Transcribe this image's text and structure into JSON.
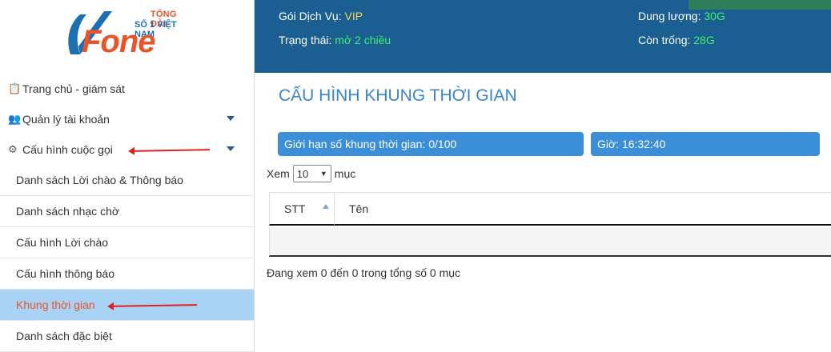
{
  "logo": {
    "tagline1": "TỔNG ĐÀI",
    "tagline2": "SỐ 1 VIỆT NAM",
    "brand": "Fone"
  },
  "sidebar": {
    "items": [
      {
        "label": "Trang chủ - giám sát",
        "icon": "clipboard-icon"
      },
      {
        "label": "Quản lý tài khoản",
        "icon": "users-icon",
        "caret": true
      },
      {
        "label": "Cấu hình cuộc gọi",
        "icon": "gears-icon",
        "caret": true
      }
    ],
    "subitems": [
      {
        "label": "Danh sách Lời chào & Thông báo"
      },
      {
        "label": "Danh sách nhạc chờ"
      },
      {
        "label": "Cấu hình Lời chào"
      },
      {
        "label": "Cấu hình thông báo"
      },
      {
        "label": "Khung thời gian",
        "active": true
      },
      {
        "label": "Danh sách đặc biệt"
      }
    ]
  },
  "topbar": {
    "package_label": "Gói Dịch Vụ: ",
    "package_value": "VIP",
    "status_label": "Trạng thái: ",
    "status_value": "mở 2 chiều",
    "capacity_label": "Dung lượng: ",
    "capacity_value": "30G",
    "free_label": "Còn trống: ",
    "free_value": "28G"
  },
  "main": {
    "title": "CẤU HÌNH KHUNG THỜI GIAN",
    "limit_text": "Giới hạn số khung thời gian:  0/100",
    "time_text": "Giờ:  16:32:40",
    "show_prefix": "Xem",
    "page_size": "10",
    "show_suffix": "mục",
    "columns": [
      "STT",
      "Tên"
    ],
    "info": "Đang xem 0 đến 0 trong tổng số 0 mục"
  },
  "colors": {
    "accent": "#3a8fd8",
    "topbar": "#1b5f92",
    "active_row": "#a9d3f5",
    "brand_orange": "#e8542a",
    "annotation_arrow": "#e02020"
  }
}
